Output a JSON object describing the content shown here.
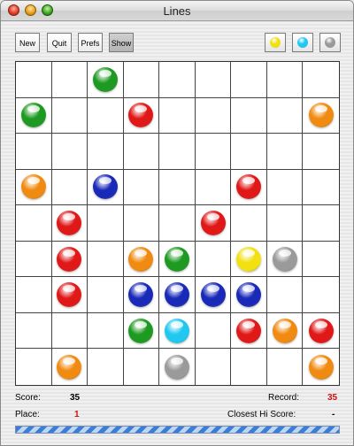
{
  "window": {
    "title": "Lines"
  },
  "toolbar": {
    "buttons": [
      "New",
      "Quit",
      "Prefs",
      "Show"
    ],
    "active_button": "Show",
    "next_balls": [
      "yellow",
      "cyan",
      "gray"
    ]
  },
  "colors": {
    "green": "#1e9a22",
    "red": "#e01818",
    "orange": "#f08a10",
    "blue": "#1a2ab8",
    "yellow": "#f2e010",
    "cyan": "#20c8f0",
    "gray": "#9a9a9a"
  },
  "board": {
    "rows": 9,
    "cols": 9,
    "balls": [
      {
        "row": 0,
        "col": 2,
        "color": "green"
      },
      {
        "row": 1,
        "col": 0,
        "color": "green"
      },
      {
        "row": 1,
        "col": 3,
        "color": "red"
      },
      {
        "row": 1,
        "col": 8,
        "color": "orange"
      },
      {
        "row": 3,
        "col": 0,
        "color": "orange"
      },
      {
        "row": 3,
        "col": 2,
        "color": "blue"
      },
      {
        "row": 3,
        "col": 6,
        "color": "red"
      },
      {
        "row": 4,
        "col": 1,
        "color": "red"
      },
      {
        "row": 4,
        "col": 5,
        "color": "red"
      },
      {
        "row": 5,
        "col": 1,
        "color": "red"
      },
      {
        "row": 5,
        "col": 3,
        "color": "orange"
      },
      {
        "row": 5,
        "col": 4,
        "color": "green"
      },
      {
        "row": 5,
        "col": 6,
        "color": "yellow"
      },
      {
        "row": 5,
        "col": 7,
        "color": "gray"
      },
      {
        "row": 6,
        "col": 1,
        "color": "red"
      },
      {
        "row": 6,
        "col": 3,
        "color": "blue"
      },
      {
        "row": 6,
        "col": 4,
        "color": "blue"
      },
      {
        "row": 6,
        "col": 5,
        "color": "blue"
      },
      {
        "row": 6,
        "col": 6,
        "color": "blue"
      },
      {
        "row": 7,
        "col": 3,
        "color": "green"
      },
      {
        "row": 7,
        "col": 4,
        "color": "cyan"
      },
      {
        "row": 7,
        "col": 6,
        "color": "red"
      },
      {
        "row": 7,
        "col": 7,
        "color": "orange"
      },
      {
        "row": 7,
        "col": 8,
        "color": "red"
      },
      {
        "row": 8,
        "col": 1,
        "color": "orange"
      },
      {
        "row": 8,
        "col": 4,
        "color": "gray"
      },
      {
        "row": 8,
        "col": 8,
        "color": "orange"
      }
    ]
  },
  "stats": {
    "score_label": "Score:",
    "score": "35",
    "record_label": "Record:",
    "record": "35",
    "place_label": "Place:",
    "place": "1",
    "closest_label": "Closest Hi Score:",
    "closest": "-"
  },
  "status": {
    "progress": 1.0
  }
}
